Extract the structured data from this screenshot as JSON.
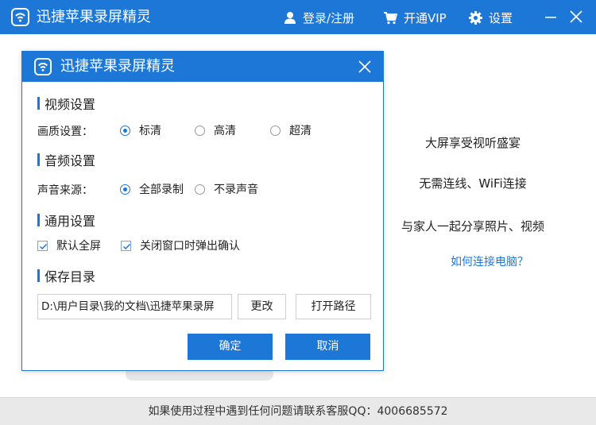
{
  "app": {
    "title": "迅捷苹果录屏精灵",
    "header_color": "#1d77d7"
  },
  "topbar": {
    "login_label": "登录/注册",
    "vip_label": "开通VIP",
    "settings_label": "设置",
    "icons": [
      "user-icon",
      "cart-icon",
      "gear-icon",
      "minimize-icon",
      "close-icon"
    ]
  },
  "main": {
    "promo_lines": [
      "大屏享受视听盛宴",
      "无需连线、WiFi连接",
      "与家人一起分享照片、视频"
    ],
    "connect_link": "如何连接电脑？"
  },
  "footer": {
    "support_text": "如果使用过程中遇到任何问题请联系客服QQ：4006685572"
  },
  "dialog": {
    "title": "迅捷苹果录屏精灵",
    "video": {
      "section_title": "视频设置",
      "quality_label": "画质设置：",
      "options": [
        {
          "label": "标清",
          "checked": true
        },
        {
          "label": "高清",
          "checked": false
        },
        {
          "label": "超清",
          "checked": false
        }
      ]
    },
    "audio": {
      "section_title": "音频设置",
      "source_label": "声音来源：",
      "options": [
        {
          "label": "全部录制",
          "checked": true
        },
        {
          "label": "不录声音",
          "checked": false
        }
      ]
    },
    "general": {
      "section_title": "通用设置",
      "options": [
        {
          "label": "默认全屏",
          "checked": true
        },
        {
          "label": "关闭窗口时弹出确认",
          "checked": true
        }
      ]
    },
    "save": {
      "section_title": "保存目录",
      "path_value": "D:\\用户目录\\我的文档\\迅捷苹果录屏",
      "change_label": "更改",
      "open_path_label": "打开路径"
    },
    "ok_label": "确定",
    "cancel_label": "取消"
  }
}
